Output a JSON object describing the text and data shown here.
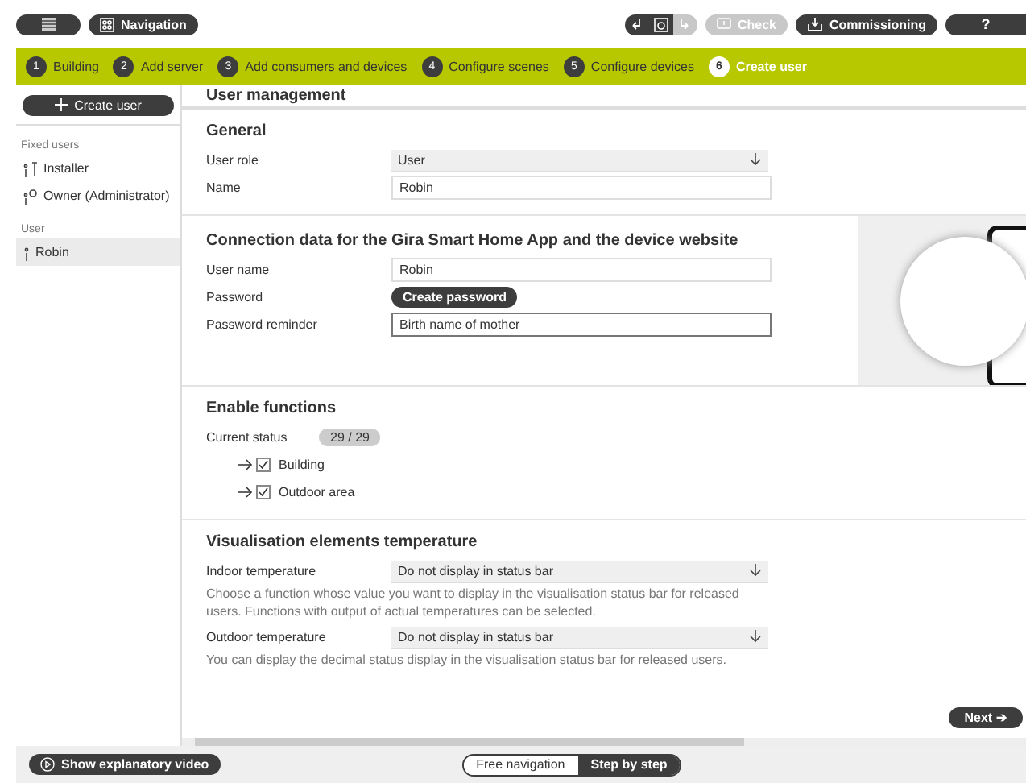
{
  "toolbar": {
    "navigation_label": "Navigation",
    "undo_disabled": false,
    "redo_disabled": true,
    "check": {
      "label": "Check",
      "disabled": true
    },
    "commissioning_label": "Commissioning",
    "help_label": "?"
  },
  "steps": [
    {
      "number": "1",
      "label": "Building",
      "selected": false
    },
    {
      "number": "2",
      "label": "Add server",
      "selected": false
    },
    {
      "number": "3",
      "label": "Add consumers and devices",
      "selected": false
    },
    {
      "number": "4",
      "label": "Configure scenes",
      "selected": false
    },
    {
      "number": "5",
      "label": "Configure devices",
      "selected": false
    },
    {
      "number": "6",
      "label": "Create user",
      "selected": true
    }
  ],
  "sidebar": {
    "create_button": "Create user",
    "groups": [
      {
        "heading": "Fixed users",
        "items": [
          {
            "label": "Installer",
            "kind": "installer",
            "selected": false
          },
          {
            "label": "Owner (Administrator)",
            "kind": "owner",
            "selected": false
          }
        ]
      },
      {
        "heading": "User",
        "items": [
          {
            "label": "Robin",
            "kind": "user",
            "selected": true
          }
        ]
      }
    ]
  },
  "main": {
    "title": "User management",
    "general": {
      "heading": "General",
      "fields": [
        {
          "label": "User role",
          "kind": "select",
          "value": "User"
        },
        {
          "label": "Name",
          "kind": "text",
          "value": "Robin"
        }
      ]
    },
    "connection": {
      "heading": "Connection data for the Gira Smart Home App and the device website",
      "fields": [
        {
          "label": "User name",
          "kind": "text",
          "value": "Robin"
        },
        {
          "label": "Password",
          "kind": "button",
          "value": "Create password"
        },
        {
          "label": "Password reminder",
          "kind": "focused",
          "value": "Birth name of mother"
        }
      ]
    },
    "enable": {
      "heading": "Enable functions",
      "status_label": "Current status",
      "status_value": "29 / 29",
      "items": [
        {
          "label": "Building",
          "checked": true
        },
        {
          "label": "Outdoor area",
          "checked": true
        }
      ]
    },
    "visualisation": {
      "heading": "Visualisation elements temperature",
      "rows": [
        {
          "label": "Indoor temperature",
          "value": "Do not display in status bar",
          "hint": "Choose a function whose value you want to display in the visualisation status bar for released users. Functions with output of actual temperatures can be selected."
        },
        {
          "label": "Outdoor temperature",
          "value": "Do not display in status bar",
          "hint": "You can display the decimal status display in the visualisation status bar for released users."
        }
      ]
    },
    "next_label": "Next ➔"
  },
  "footer": {
    "video_label": "Show explanatory video",
    "modes": [
      {
        "label": "Free navigation",
        "selected": false
      },
      {
        "label": "Step by step",
        "selected": true
      }
    ]
  }
}
